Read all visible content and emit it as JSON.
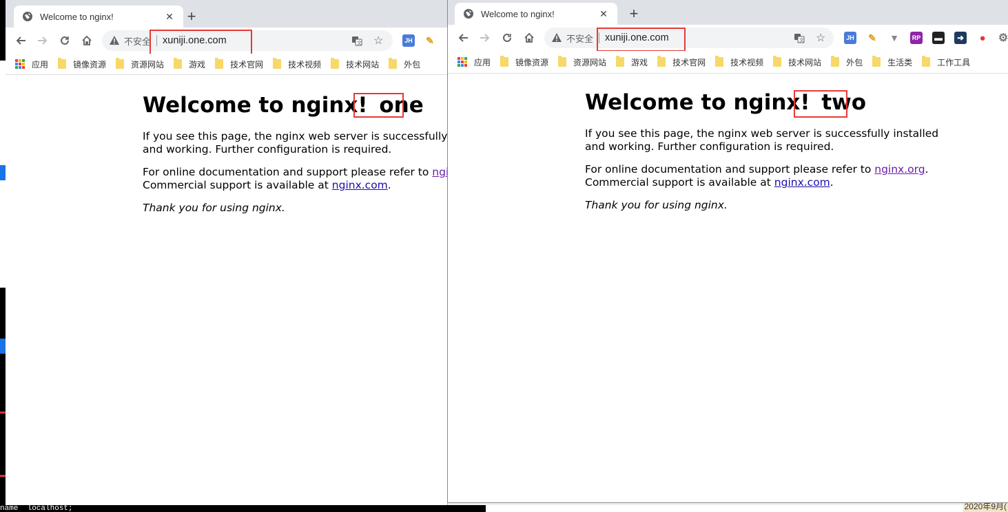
{
  "background": {
    "terminal_text": "name  localhost;",
    "clock_date": "2020年9月("
  },
  "windows": [
    {
      "id": "one",
      "tab": {
        "title": "Welcome to nginx!"
      },
      "address": {
        "insecure_label": "不安全",
        "url": "xuniji.one.com"
      },
      "extensions": [
        "JH",
        "pen-extension"
      ],
      "bookmarks": [
        "应用",
        "镜像资源",
        "资源网站",
        "游戏",
        "技术官网",
        "技术视频",
        "技术网站",
        "外包"
      ],
      "page": {
        "heading": "Welcome to nginx!",
        "heading_suffix": "one",
        "para1": "If you see this page, the nginx web server is successfully installed and working. Further configuration is required.",
        "para2_prefix": "For online documentation and support please refer to ",
        "link1": "nginx.org",
        "para2_mid": ".",
        "para2_line2": "Commercial support is available at ",
        "link2": "nginx.com",
        "para2_end": ".",
        "thanks": "Thank you for using nginx."
      }
    },
    {
      "id": "two",
      "tab": {
        "title": "Welcome to nginx!"
      },
      "address": {
        "insecure_label": "不安全",
        "url": "xuniji.one.com"
      },
      "extensions": [
        "JH",
        "pen-extension",
        "vue-extension",
        "RP",
        "mask-extension",
        "arrow-extension",
        "maps-extension",
        "gear-extension"
      ],
      "bookmarks": [
        "应用",
        "镜像资源",
        "资源网站",
        "游戏",
        "技术官网",
        "技术视频",
        "技术网站",
        "外包",
        "生活类",
        "工作工具"
      ],
      "page": {
        "heading": "Welcome to nginx!",
        "heading_suffix": "two",
        "para1": "If you see this page, the nginx web server is successfully installed and working. Further configuration is required.",
        "para2_prefix": "For online documentation and support please refer to ",
        "link1": "nginx.org",
        "para2_mid": ".",
        "para2_line2": "Commercial support is available at ",
        "link2": "nginx.com",
        "para2_end": ".",
        "thanks": "Thank you for using nginx."
      }
    }
  ],
  "colors": {
    "highlight": "#e53935",
    "link": "#1a0dab",
    "visited_link": "#681da8",
    "tabstrip": "#dee1e6"
  }
}
